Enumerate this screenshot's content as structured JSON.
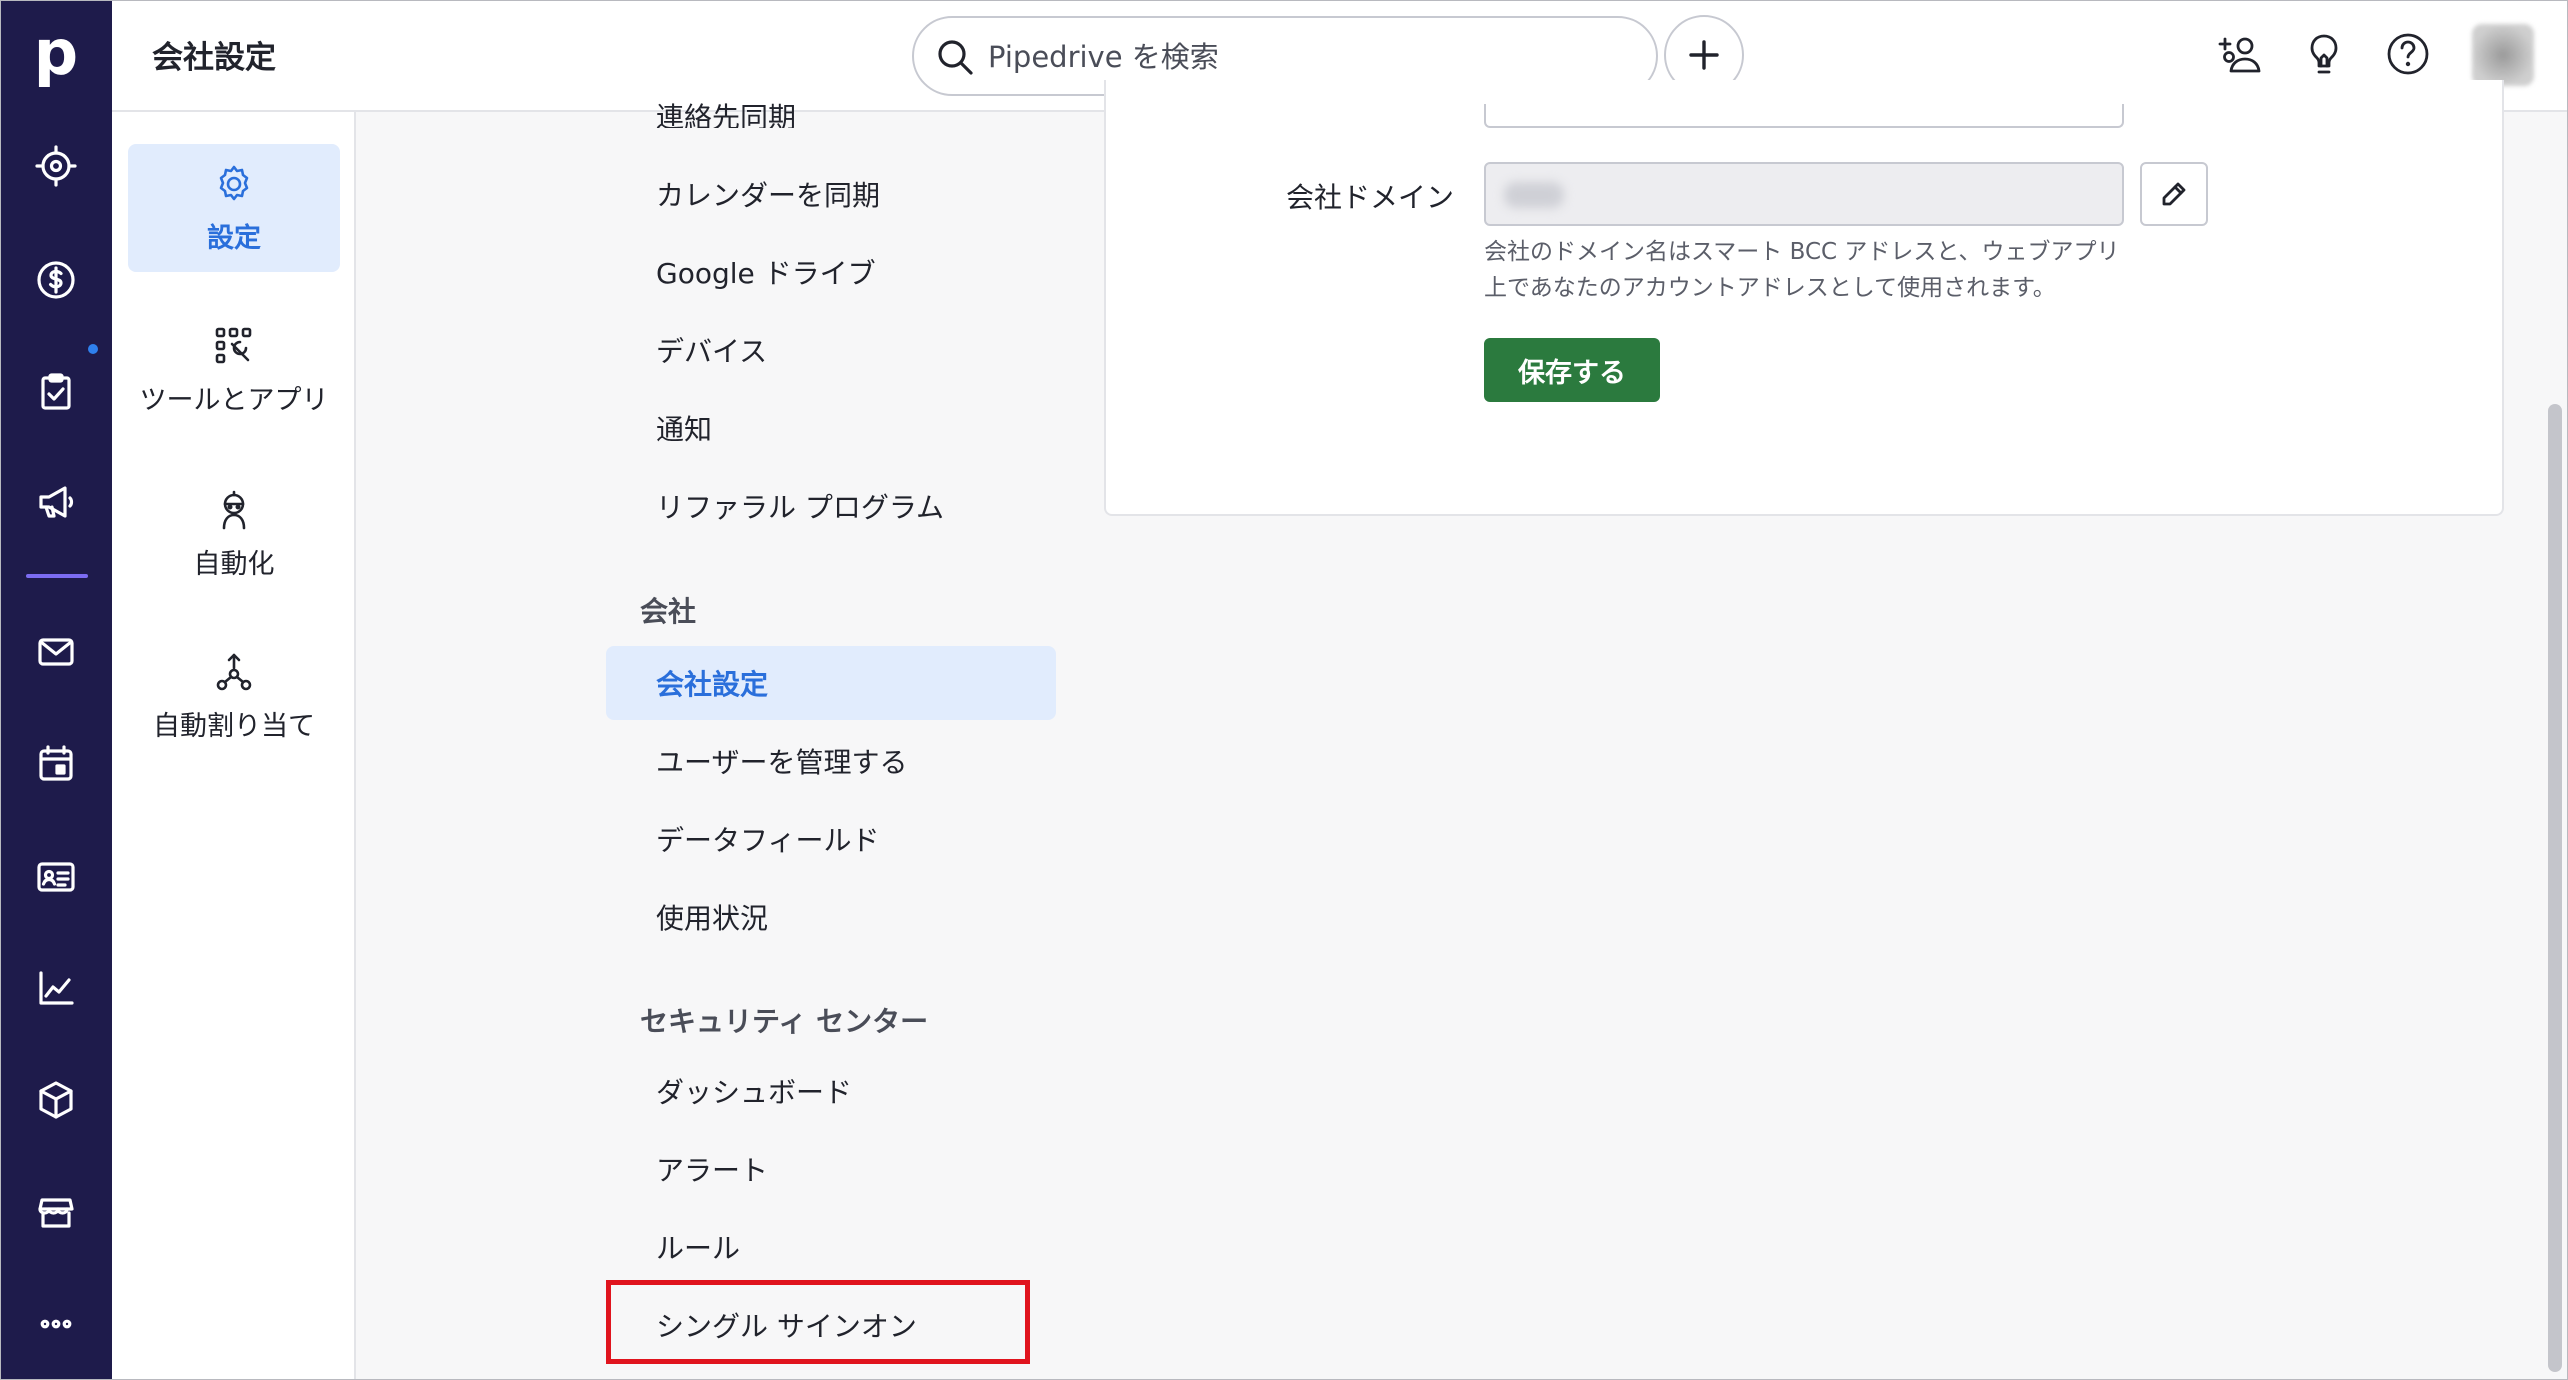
{
  "header": {
    "title": "会社設定",
    "search_placeholder": "Pipedrive を検索"
  },
  "rail": {
    "logo": "p",
    "items": [
      "target-icon",
      "dollar-icon",
      "clipboard-check-icon",
      "megaphone-icon",
      "mail-icon",
      "calendar-icon",
      "contact-card-icon",
      "chart-icon",
      "box-icon",
      "store-icon",
      "more-icon"
    ]
  },
  "categories": [
    {
      "label": "設定",
      "icon": "gear-icon",
      "active": true
    },
    {
      "label": "ツールとアプリ",
      "icon": "tools-icon",
      "active": false
    },
    {
      "label": "自動化",
      "icon": "robot-icon",
      "active": false
    },
    {
      "label": "自動割り当て",
      "icon": "assignment-icon",
      "active": false
    }
  ],
  "subnav": {
    "partial_top": "連絡先同期",
    "personal_items": [
      "カレンダーを同期",
      "Google ドライブ",
      "デバイス",
      "通知",
      "リファラル プログラム"
    ],
    "company_heading": "会社",
    "company_items": [
      "会社設定",
      "ユーザーを管理する",
      "データフィールド",
      "使用状況"
    ],
    "security_heading": "セキュリティ センター",
    "security_items": [
      "ダッシュボード",
      "アラート",
      "ルール",
      "シングル サインオン"
    ]
  },
  "form": {
    "domain_label": "会社ドメイン",
    "domain_help": "会社のドメイン名はスマート BCC アドレスと、ウェブアプリ上であなたのアカウントアドレスとして使用されます。",
    "save_label": "保存する"
  },
  "colors": {
    "rail_bg": "#1e1b4b",
    "accent_blue": "#2a6fdb",
    "active_bg": "#e1ecfd",
    "save_green": "#2b7a3e",
    "highlight_red": "#e0141e"
  }
}
